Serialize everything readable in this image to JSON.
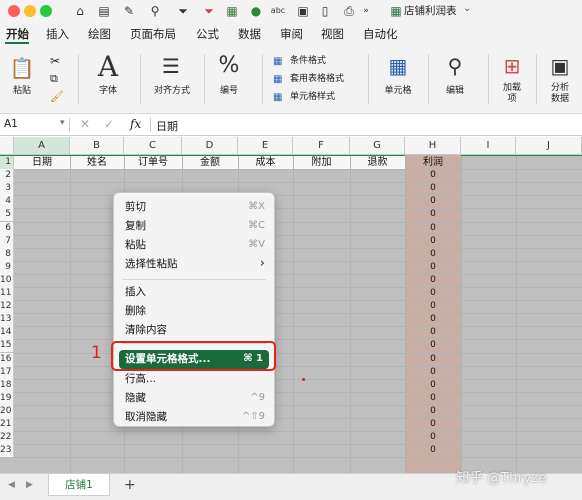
{
  "app": {
    "workbook_title": "店铺利润表",
    "title_chevron": "⌄",
    "accent_color": "#217346",
    "highlight_color": "#e2231a"
  },
  "ribbon_tabs": [
    "开始",
    "插入",
    "绘图",
    "页面布局",
    "公式",
    "数据",
    "审阅",
    "视图",
    "自动化"
  ],
  "ribbon": {
    "paste": "粘贴",
    "font": "字体",
    "alignment": "对齐方式",
    "number": "编号",
    "conditional_format": "条件格式",
    "table_format": "套用表格格式",
    "cell_style": "单元格样式",
    "cells": "单元格",
    "edit": "编辑",
    "addins": "加载\n项",
    "analyze": "分析\n数据"
  },
  "formula_bar": {
    "name_box": "A1",
    "fx": "fx",
    "content": "日期"
  },
  "sheet": {
    "columns": [
      "A",
      "B",
      "C",
      "D",
      "E",
      "F",
      "G",
      "H",
      "I",
      "J"
    ],
    "rows": [
      "1",
      "2",
      "3",
      "4",
      "5",
      "6",
      "7",
      "8",
      "9",
      "10",
      "11",
      "12",
      "13",
      "14",
      "15",
      "16",
      "17",
      "18",
      "19",
      "20",
      "21",
      "22",
      "23"
    ],
    "headers": [
      "日期",
      "姓名",
      "订单号",
      "金额",
      "成本",
      "附加",
      "退款",
      "利润"
    ],
    "profit_values": [
      "0",
      "0",
      "0",
      "0",
      "0",
      "0",
      "0",
      "0",
      "0",
      "0",
      "0",
      "0",
      "0",
      "0",
      "0",
      "0",
      "0",
      "0",
      "0",
      "0",
      "0",
      "0"
    ],
    "highlight_col_color": "#c8aea4"
  },
  "context_menu": {
    "items": [
      {
        "label": "剪切",
        "shortcut": "⌘X"
      },
      {
        "label": "复制",
        "shortcut": "⌘C"
      },
      {
        "label": "粘贴",
        "shortcut": "⌘V"
      },
      {
        "label": "选择性粘贴",
        "shortcut": "›"
      },
      {
        "label": "插入",
        "shortcut": ""
      },
      {
        "label": "删除",
        "shortcut": ""
      },
      {
        "label": "清除内容",
        "shortcut": ""
      },
      {
        "label": "设置单元格格式...",
        "shortcut": "⌘ 1"
      },
      {
        "label": "行高...",
        "shortcut": ""
      },
      {
        "label": "隐藏",
        "shortcut": "^9"
      },
      {
        "label": "取消隐藏",
        "shortcut": "^⇧9"
      }
    ]
  },
  "annotation": {
    "step": "1"
  },
  "sheet_tabs": {
    "active": "店铺1",
    "add": "+"
  },
  "watermark": "知乎 @Thryze"
}
